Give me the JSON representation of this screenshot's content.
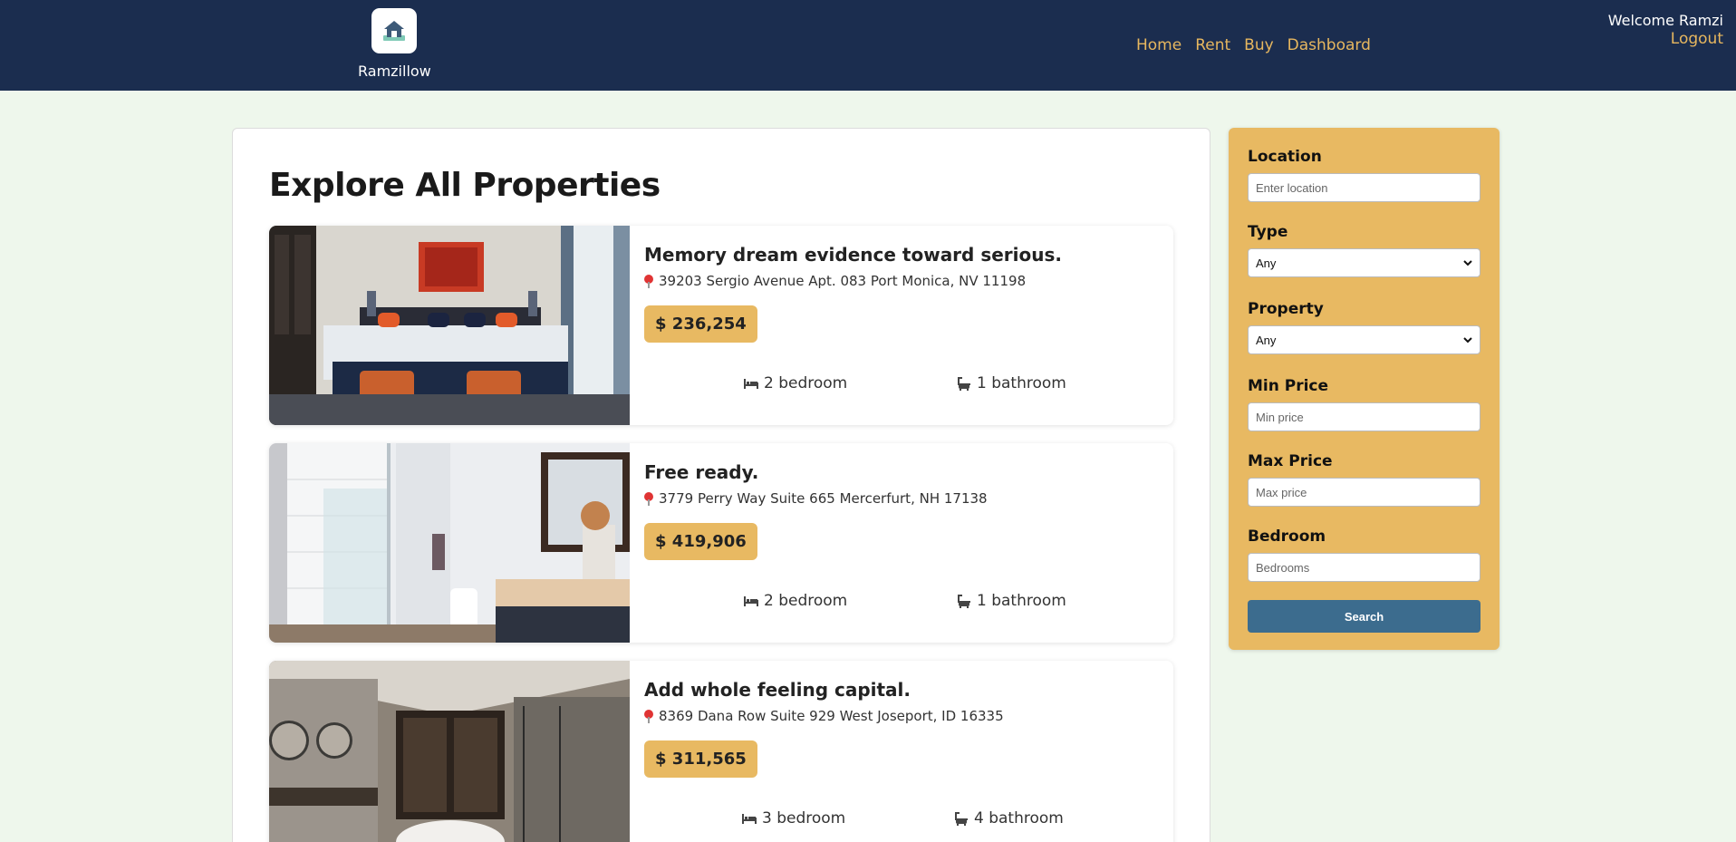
{
  "header": {
    "brand": "Ramzillow",
    "nav": [
      "Home",
      "Rent",
      "Buy",
      "Dashboard"
    ],
    "welcome": "Welcome Ramzi",
    "logout": "Logout"
  },
  "main": {
    "title": "Explore All Properties",
    "listings": [
      {
        "title": "Memory dream evidence toward serious.",
        "address": "39203 Sergio Avenue Apt. 083 Port Monica, NV 11198",
        "price": "$ 236,254",
        "bedrooms": "2 bedroom",
        "bathrooms": "1 bathroom"
      },
      {
        "title": "Free ready.",
        "address": "3779 Perry Way Suite 665 Mercerfurt, NH 17138",
        "price": "$ 419,906",
        "bedrooms": "2 bedroom",
        "bathrooms": "1 bathroom"
      },
      {
        "title": "Add whole feeling capital.",
        "address": "8369 Dana Row Suite 929 West Joseport, ID 16335",
        "price": "$ 311,565",
        "bedrooms": "3 bedroom",
        "bathrooms": "4 bathroom"
      }
    ]
  },
  "filter": {
    "location_label": "Location",
    "location_placeholder": "Enter location",
    "type_label": "Type",
    "type_value": "Any",
    "property_label": "Property",
    "property_value": "Any",
    "min_price_label": "Min Price",
    "min_price_placeholder": "Min price",
    "max_price_label": "Max Price",
    "max_price_placeholder": "Max price",
    "bedroom_label": "Bedroom",
    "bedroom_placeholder": "Bedrooms",
    "search_label": "Search"
  },
  "colors": {
    "header_bg": "#1b2d4f",
    "accent": "#e8b962",
    "search_button": "#3c6c8e",
    "page_bg": "#eef7ec"
  },
  "icons": [
    "house-logo-icon",
    "map-pin-icon",
    "bed-icon",
    "bath-icon",
    "chevron-down-icon"
  ]
}
